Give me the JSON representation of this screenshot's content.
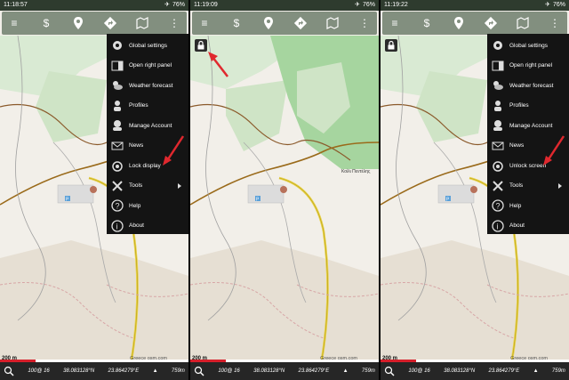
{
  "panels": [
    {
      "status": {
        "time": "11:18:57",
        "battery": "76%"
      },
      "menu_visible": true,
      "lock_visible": false,
      "menu": [
        {
          "label": "Global settings",
          "icon": "gear-icon"
        },
        {
          "label": "Open right panel",
          "icon": "right-panel-icon"
        },
        {
          "label": "Weather forecast",
          "icon": "weather-icon"
        },
        {
          "label": "Profiles",
          "icon": "profiles-icon"
        },
        {
          "label": "Manage Account",
          "icon": "account-icon"
        },
        {
          "label": "News",
          "icon": "news-icon"
        },
        {
          "label": "Lock display",
          "icon": "lock-display-icon"
        },
        {
          "label": "Tools",
          "icon": "tools-icon",
          "submenu": true
        },
        {
          "label": "Help",
          "icon": "help-icon"
        },
        {
          "label": "About",
          "icon": "about-icon"
        }
      ],
      "bottom": {
        "zoom": "100@ 16",
        "lat": "38.083128°N",
        "lon": "23.864279°E",
        "alt": "759m"
      },
      "scale": "200 m",
      "attribution": "Greece osm.com"
    },
    {
      "status": {
        "time": "11:19:09",
        "battery": "76%"
      },
      "menu_visible": false,
      "lock_visible": true,
      "place_label": "Κοίλι Πεντέλης",
      "bottom": {
        "zoom": "100@ 16",
        "lat": "38.083128°N",
        "lon": "23.864279°E",
        "alt": "759m"
      },
      "scale": "200 m",
      "attribution": "Greece osm.com"
    },
    {
      "status": {
        "time": "11:19:22",
        "battery": "76%"
      },
      "menu_visible": true,
      "lock_visible": true,
      "menu": [
        {
          "label": "Global settings",
          "icon": "gear-icon"
        },
        {
          "label": "Open right panel",
          "icon": "right-panel-icon"
        },
        {
          "label": "Weather forecast",
          "icon": "weather-icon"
        },
        {
          "label": "Profiles",
          "icon": "profiles-icon"
        },
        {
          "label": "Manage Account",
          "icon": "account-icon"
        },
        {
          "label": "News",
          "icon": "news-icon"
        },
        {
          "label": "Unlock screen",
          "icon": "unlock-screen-icon"
        },
        {
          "label": "Tools",
          "icon": "tools-icon",
          "submenu": true
        },
        {
          "label": "Help",
          "icon": "help-icon"
        },
        {
          "label": "About",
          "icon": "about-icon"
        }
      ],
      "bottom": {
        "zoom": "100@ 16",
        "lat": "38.083128°N",
        "lon": "23.864279°E",
        "alt": "759m"
      },
      "scale": "200 m",
      "attribution": "Greece osm.com"
    }
  ],
  "colors": {
    "annotation_arrow": "#e0282e",
    "menu_bg": "#141414",
    "toolbar_bg": "#7d8a7a",
    "forest": "#a6d59f"
  }
}
